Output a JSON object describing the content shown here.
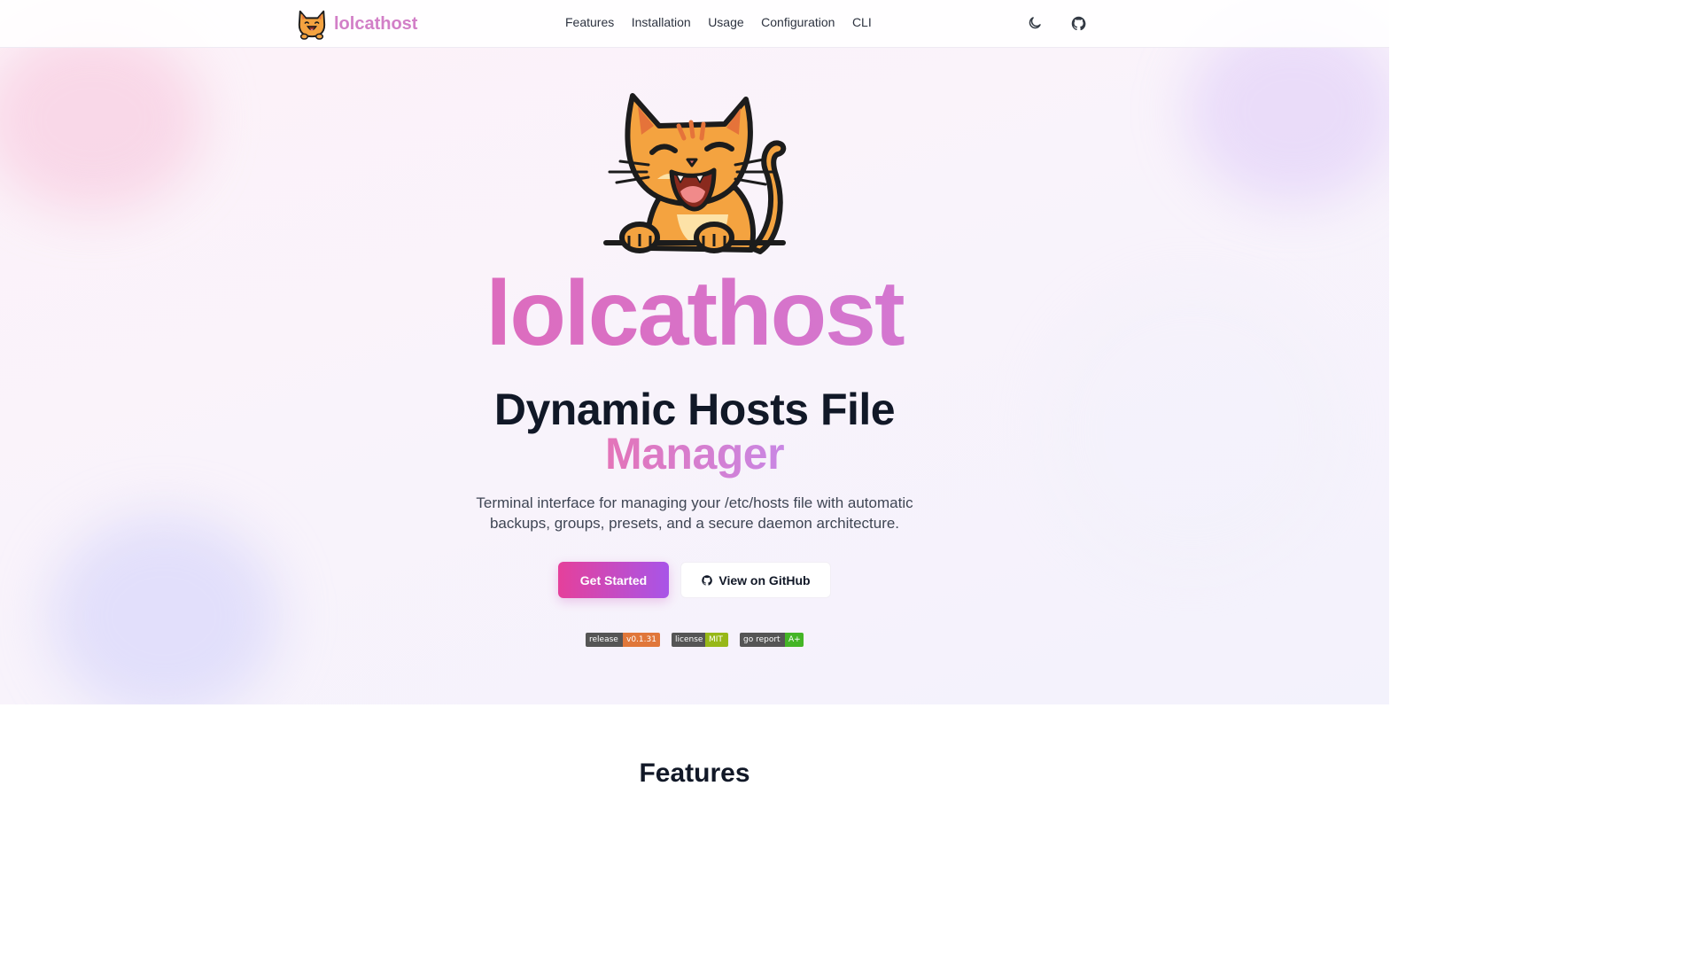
{
  "nav": {
    "brand": "lolcathost",
    "links": [
      "Features",
      "Installation",
      "Usage",
      "Configuration",
      "CLI"
    ],
    "theme_icon": "moon-icon",
    "github_icon": "github-icon"
  },
  "hero": {
    "name": "lolcathost",
    "title": "Dynamic Hosts File",
    "title_accent": "Manager",
    "description": "Terminal interface for managing your /etc/hosts file with automatic backups, groups, presets, and a secure daemon architecture.",
    "primary_button": "Get Started",
    "secondary_button": "View on GitHub",
    "badges": [
      {
        "label": "release",
        "value": "v0.1.31",
        "color": "#e0773a"
      },
      {
        "label": "license",
        "value": "MIT",
        "color": "#97b818"
      },
      {
        "label": "go report",
        "value": "A+",
        "color": "#44b526"
      }
    ]
  },
  "features": {
    "heading": "Features"
  },
  "colors": {
    "accent_pink": "#e5409b",
    "accent_purple": "#a855e8",
    "heading": "#111827"
  }
}
